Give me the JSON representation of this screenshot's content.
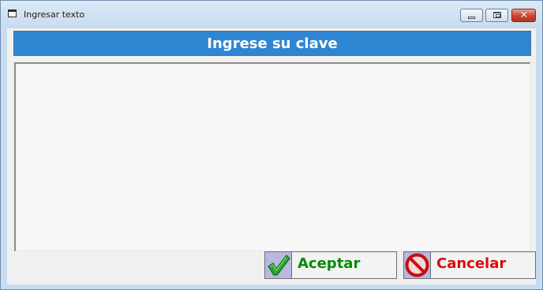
{
  "window": {
    "title": "Ingresar texto",
    "controls": {
      "minimize_icon": "minimize-icon",
      "maximize_icon": "maximize-icon",
      "close_icon": "close-icon",
      "close_glyph": "✕"
    }
  },
  "header": {
    "text": "Ingrese su clave",
    "background": "#2e86d3",
    "text_color": "#ffffff"
  },
  "input": {
    "value": ""
  },
  "buttons": {
    "accept": {
      "label": "Aceptar",
      "icon": "checkmark-icon",
      "color": "#078a07"
    },
    "cancel": {
      "label": "Cancelar",
      "icon": "no-entry-icon",
      "color": "#dd0b0b"
    }
  }
}
